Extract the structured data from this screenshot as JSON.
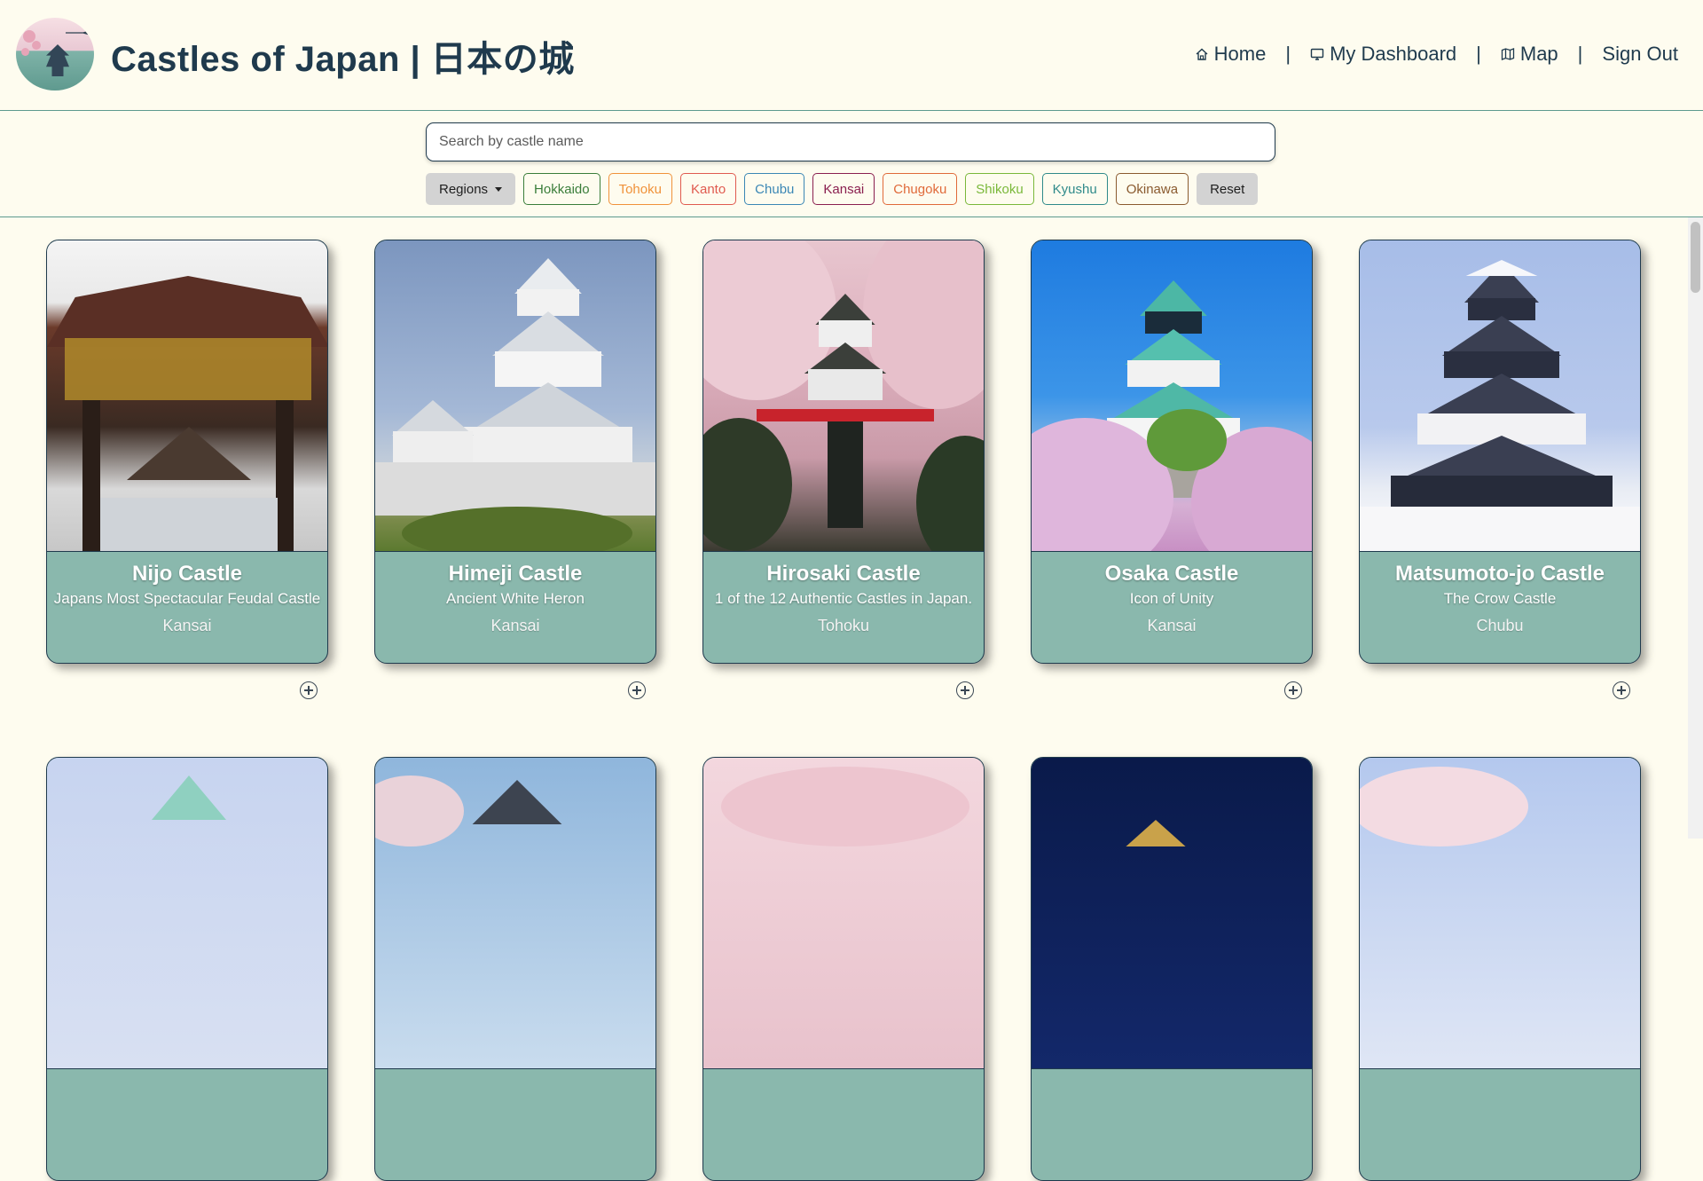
{
  "header": {
    "title": "Castles of Japan | 日本の城",
    "nav": [
      {
        "label": "Home",
        "icon": "home-icon"
      },
      {
        "label": "My Dashboard",
        "icon": "monitor-icon"
      },
      {
        "label": "Map",
        "icon": "map-icon"
      },
      {
        "label": "Sign Out",
        "icon": ""
      }
    ],
    "separator": "|"
  },
  "search": {
    "placeholder": "Search by castle name",
    "value": ""
  },
  "filters": {
    "regions_label": "Regions",
    "reset_label": "Reset",
    "regions": [
      {
        "label": "Hokkaido",
        "color": "#3a7d3a"
      },
      {
        "label": "Tohoku",
        "color": "#f0923a"
      },
      {
        "label": "Kanto",
        "color": "#e05a4f"
      },
      {
        "label": "Chubu",
        "color": "#3b87b5"
      },
      {
        "label": "Kansai",
        "color": "#8a1f4f"
      },
      {
        "label": "Chugoku",
        "color": "#e06a3a"
      },
      {
        "label": "Shikoku",
        "color": "#7ab83a"
      },
      {
        "label": "Kyushu",
        "color": "#2f8a8a"
      },
      {
        "label": "Okinawa",
        "color": "#8a5a2f"
      }
    ]
  },
  "cards": [
    {
      "name": "Nijo Castle",
      "tagline": "Japans Most Spectacular Feudal Castle",
      "region": "Kansai"
    },
    {
      "name": "Himeji Castle",
      "tagline": "Ancient White Heron",
      "region": "Kansai"
    },
    {
      "name": "Hirosaki Castle",
      "tagline": "1 of the 12 Authentic Castles in Japan.",
      "region": "Tohoku"
    },
    {
      "name": "Osaka Castle",
      "tagline": "Icon of Unity",
      "region": "Kansai"
    },
    {
      "name": "Matsumoto-jo Castle",
      "tagline": "The Crow Castle",
      "region": "Chubu"
    }
  ],
  "colors": {
    "background": "#fefcef",
    "card": "#8ab8ad",
    "accent_line": "#5d9a8f",
    "text_dark": "#1f3a4d"
  }
}
